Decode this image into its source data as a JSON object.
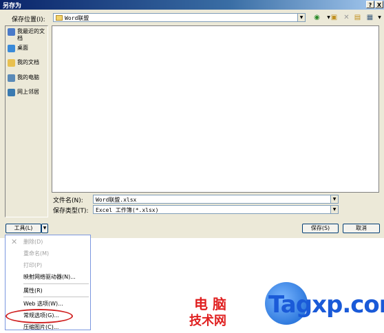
{
  "window": {
    "title": "另存为",
    "help": "?",
    "close": "X"
  },
  "location": {
    "label": "保存位置(I):",
    "value": "Word联盟"
  },
  "toolbar": {
    "back_icon": "back-icon",
    "up_icon": "up-folder-icon",
    "delete_icon": "delete-icon",
    "newfolder_icon": "new-folder-icon",
    "views_icon": "views-icon"
  },
  "places": [
    {
      "label": "我最近的文档",
      "icon": "recent-icon",
      "color": "#4a7ac8"
    },
    {
      "label": "桌面",
      "icon": "desktop-icon",
      "color": "#3a8ad8"
    },
    {
      "label": "我的文档",
      "icon": "my-documents-icon",
      "color": "#e8c050"
    },
    {
      "label": "我的电脑",
      "icon": "my-computer-icon",
      "color": "#5a8ab8"
    },
    {
      "label": "网上邻居",
      "icon": "network-icon",
      "color": "#3a7ab0"
    }
  ],
  "filename": {
    "label": "文件名(N):",
    "value": "Word联盟.xlsx"
  },
  "filetype": {
    "label": "保存类型(T):",
    "value": "Excel 工作簿(*.xlsx)"
  },
  "buttons": {
    "tools": "工具(L)",
    "save": "保存(S)",
    "cancel": "取消"
  },
  "tools_menu": [
    {
      "label": "删除(D)",
      "disabled": true
    },
    {
      "label": "重命名(M)",
      "disabled": true
    },
    {
      "label": "打印(P)",
      "disabled": true
    },
    {
      "label": "映射网络驱动器(N)...",
      "disabled": false
    },
    {
      "label": "属性(R)",
      "disabled": false
    },
    {
      "label": "Web 选项(W)...",
      "disabled": false
    },
    {
      "label": "常规选项(G)...",
      "disabled": false
    },
    {
      "label": "压缩图片(C)...",
      "disabled": false
    }
  ],
  "watermark": {
    "line1": "电 脑",
    "line2": "技术网",
    "logo": "Tagxp.com"
  }
}
